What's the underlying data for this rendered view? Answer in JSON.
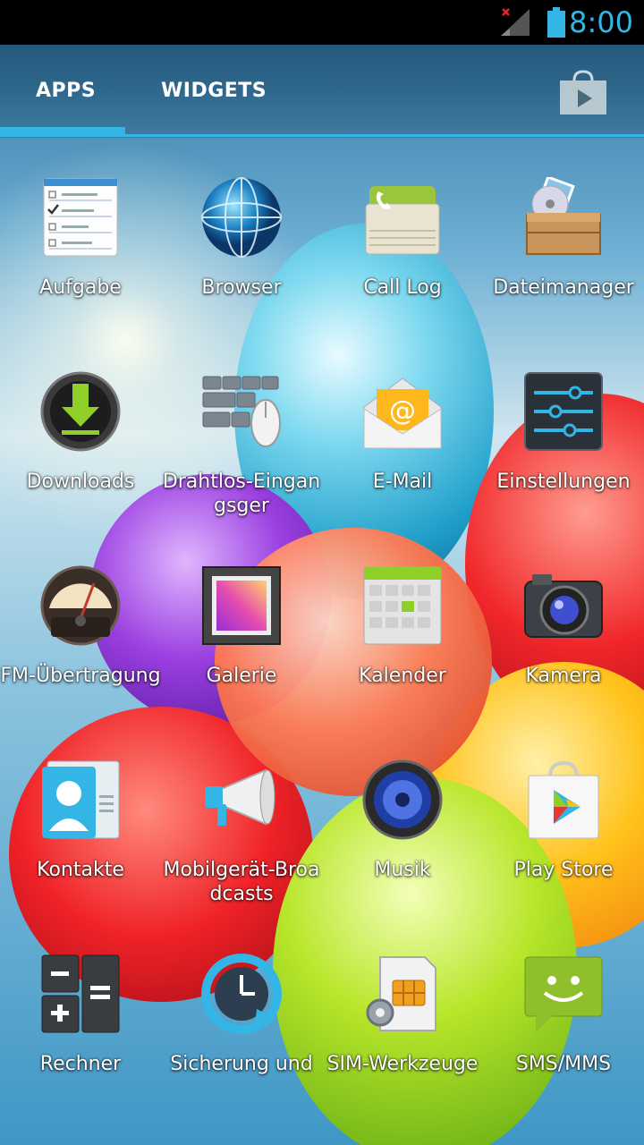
{
  "status_bar": {
    "time": "8:00",
    "icons": [
      "signal-no-service-icon",
      "battery-icon"
    ]
  },
  "tabs": [
    {
      "label": "APPS",
      "selected": true
    },
    {
      "label": "WIDGETS",
      "selected": false
    }
  ],
  "store_button": {
    "icon": "play-store-bag-icon"
  },
  "apps": [
    {
      "label": "Aufgabe",
      "icon": "task-list-icon"
    },
    {
      "label": "Browser",
      "icon": "globe-icon"
    },
    {
      "label": "Call Log",
      "icon": "call-log-folder-icon"
    },
    {
      "label": "Dateimanager",
      "icon": "file-manager-box-icon"
    },
    {
      "label": "Downloads",
      "icon": "download-arrow-icon"
    },
    {
      "label": "Drahtlos-Eingangsger",
      "icon": "keyboard-mouse-icon"
    },
    {
      "label": "E-Mail",
      "icon": "email-envelope-icon"
    },
    {
      "label": "Einstellungen",
      "icon": "settings-sliders-icon"
    },
    {
      "label": "FM-Übertragung",
      "icon": "fm-meter-icon"
    },
    {
      "label": "Galerie",
      "icon": "gallery-picture-icon"
    },
    {
      "label": "Kalender",
      "icon": "calendar-grid-icon"
    },
    {
      "label": "Kamera",
      "icon": "camera-icon"
    },
    {
      "label": "Kontakte",
      "icon": "contacts-card-icon"
    },
    {
      "label": "Mobilgerät-Broadcasts",
      "icon": "megaphone-icon"
    },
    {
      "label": "Musik",
      "icon": "speaker-icon"
    },
    {
      "label": "Play Store",
      "icon": "play-store-icon"
    },
    {
      "label": "Rechner",
      "icon": "calculator-icon"
    },
    {
      "label": "Sicherung und",
      "icon": "backup-clock-icon"
    },
    {
      "label": "SIM-Werkzeuge",
      "icon": "sim-card-gear-icon"
    },
    {
      "label": "SMS/MMS",
      "icon": "sms-bubble-icon"
    }
  ],
  "colors": {
    "accent": "#33b5e5",
    "status_bar_bg": "#000000",
    "label_text": "#ffffff"
  }
}
